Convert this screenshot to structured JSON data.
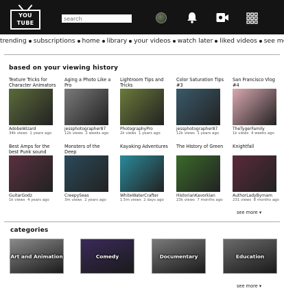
{
  "logo": {
    "line1": "YOU",
    "line2": "TUBE"
  },
  "search": {
    "placeholder": "search"
  },
  "nav": [
    "trending",
    "subscriptions",
    "home",
    "library",
    "your videos",
    "watch later",
    "liked videos",
    "see more"
  ],
  "recommended": {
    "title": "based on your viewing history",
    "see_more": "see more",
    "rows": [
      [
        {
          "title": "Texture Tricks for Character Animators",
          "channel": "AdobeWizard",
          "views": "34k views",
          "age": "1 years ago",
          "color": "#5b6b3a"
        },
        {
          "title": "Aging a Photo Like a Pro",
          "channel": "jessphotographer87",
          "views": "12k views",
          "age": "2 weeks ago",
          "color": "#7a7a7a"
        },
        {
          "title": "Lightroom Tips and Tricks",
          "channel": "PhotographyPro",
          "views": "2k views",
          "age": "1 years ago",
          "color": "#6b7a3a"
        },
        {
          "title": "Color Saturation Tips #3",
          "channel": "jessphotographer87",
          "views": "12k views",
          "age": "1 years ago",
          "color": "#3a5a6a"
        },
        {
          "title": "San Francisco Vlog #4",
          "channel": "TheTygerFamily",
          "views": "1k views",
          "age": "4 weeks ago",
          "color": "#d9a8b0"
        }
      ],
      [
        {
          "title": "Best Amps for the best Punk sound",
          "channel": "GuitarGodz",
          "views": "1k views",
          "age": "4 years ago",
          "color": "#5a3040"
        },
        {
          "title": "Monsters of the Deep",
          "channel": "CreepySeas",
          "views": "3m views",
          "age": "2 years ago",
          "color": "#2a4a5a"
        },
        {
          "title": "Kayaking Adventures",
          "channel": "WhiteWaterCrafter",
          "views": "1.5m views",
          "age": "2 days ago",
          "color": "#2a8a9a"
        },
        {
          "title": "The History of Green",
          "channel": "HistorianKavorkian",
          "views": "23k views",
          "age": "7 months ago",
          "color": "#3a6a2a"
        },
        {
          "title": "Knightfall",
          "channel": "AuthorLadyByrnam",
          "views": "231 views",
          "age": "8 months ago",
          "color": "#5a2a3a"
        }
      ]
    ]
  },
  "categories": {
    "title": "categories",
    "see_more": "see more",
    "items": [
      {
        "label": "Art and Animation",
        "color": "#8a8a8a"
      },
      {
        "label": "Comedy",
        "color": "#3a2a5a"
      },
      {
        "label": "Documentary",
        "color": "#7a7a7a"
      },
      {
        "label": "Education",
        "color": "#6a6a6a"
      }
    ]
  }
}
